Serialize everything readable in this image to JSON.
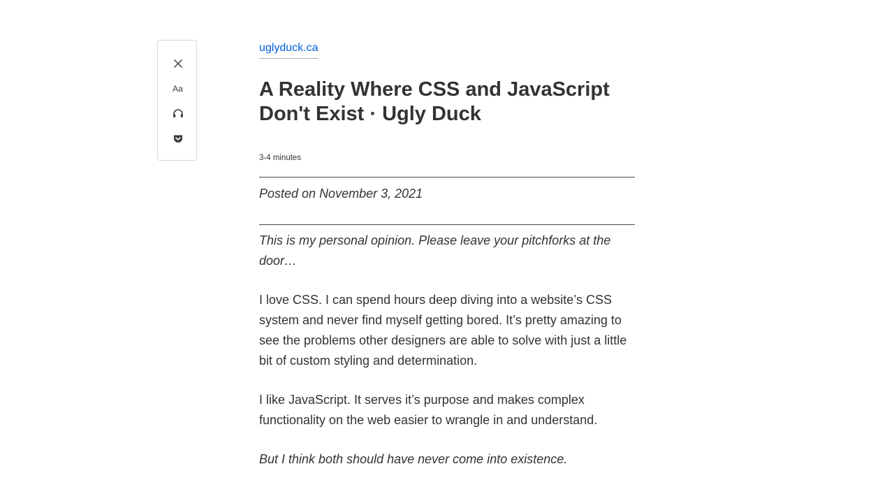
{
  "toolbar": {
    "close_icon": "close-icon",
    "type_label": "Aa",
    "listen_icon": "headphones-icon",
    "pocket_icon": "pocket-icon"
  },
  "article": {
    "domain": "uglyduck.ca",
    "title_line1": "A Reality Where CSS and JavaScript",
    "title_line2": "Don't Exist · Ugly Duck",
    "reading_time": "3-4 minutes",
    "posted": "Posted on November 3, 2021",
    "paragraphs": [
      "This is my personal opinion. Please leave your pitchforks at the door…",
      "I love CSS. I can spend hours deep diving into a website’s CSS system and never find myself getting bored. It’s pretty amazing to see the problems other designers are able to solve with just a little bit of custom styling and determination.",
      "I like JavaScript. It serves it’s purpose and makes complex functionality on the web easier to wrangle in and understand.",
      "But I think both should have never come into existence."
    ]
  },
  "colors": {
    "link": "#0060df",
    "text": "#333333",
    "border": "#d7d7db"
  }
}
